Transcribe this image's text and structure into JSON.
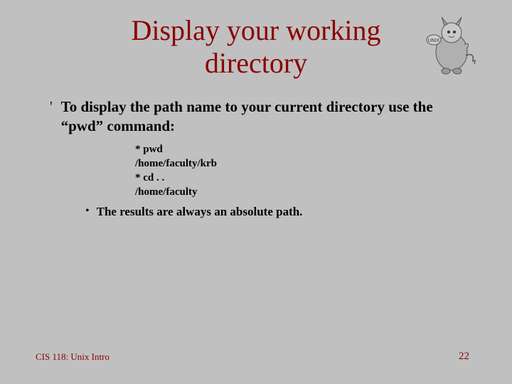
{
  "title": "Display your working directory",
  "main_bullet": {
    "marker": "'",
    "text": "To display the path name to your current directory use the “pwd” command:"
  },
  "code_lines": [
    "*  pwd",
    "/home/faculty/krb",
    "*  cd . .",
    "/home/faculty"
  ],
  "sub_bullet": {
    "marker": "•",
    "text": "The results are always an absolute path."
  },
  "footer": {
    "left": "CIS 118: Unix Intro",
    "right": "22"
  }
}
